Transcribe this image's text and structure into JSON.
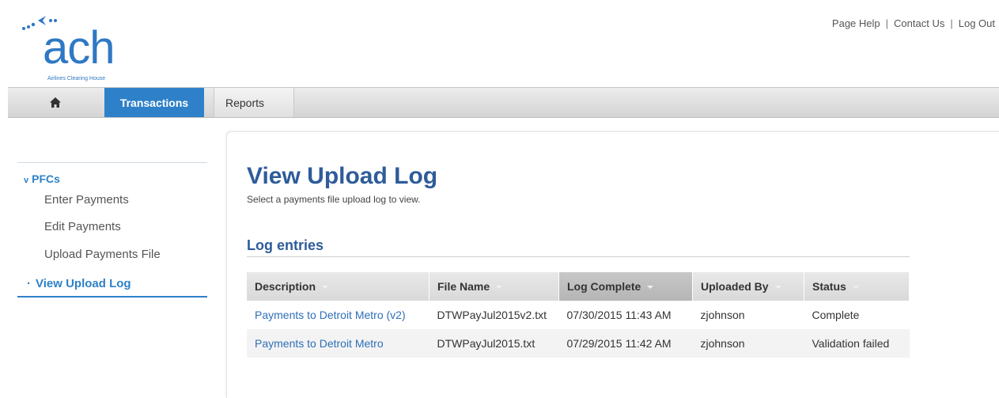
{
  "brand": {
    "logo_text": "ach",
    "logo_subtitle": "Airlines Clearing House",
    "accent_color": "#2e81c8"
  },
  "top_links": {
    "page_help": "Page Help",
    "contact_us": "Contact Us",
    "log_out": "Log Out",
    "separator": "|"
  },
  "nav": {
    "home_icon": "home-icon",
    "transactions": "Transactions",
    "reports": "Reports"
  },
  "sidebar": {
    "heading": "PFCs",
    "heading_marker": "v",
    "items": [
      {
        "label": "Enter Payments"
      },
      {
        "label": "Edit Payments"
      },
      {
        "label": "Upload Payments File"
      }
    ],
    "active_marker": "·",
    "active_item": "View Upload Log"
  },
  "main": {
    "title": "View Upload Log",
    "subtitle": "Select a payments file upload log to view.",
    "section_title": "Log entries",
    "table": {
      "columns": [
        "Description",
        "File Name",
        "Log Complete",
        "Uploaded By",
        "Status"
      ],
      "sorted_column": "Log Complete",
      "rows": [
        {
          "description": "Payments to Detroit Metro (v2)",
          "file_name": "DTWPayJul2015v2.txt",
          "log_complete": "07/30/2015 11:43 AM",
          "uploaded_by": "zjohnson",
          "status": "Complete"
        },
        {
          "description": "Payments to Detroit Metro",
          "file_name": "DTWPayJul2015.txt",
          "log_complete": "07/29/2015 11:42 AM",
          "uploaded_by": "zjohnson",
          "status": "Validation failed"
        }
      ]
    }
  }
}
